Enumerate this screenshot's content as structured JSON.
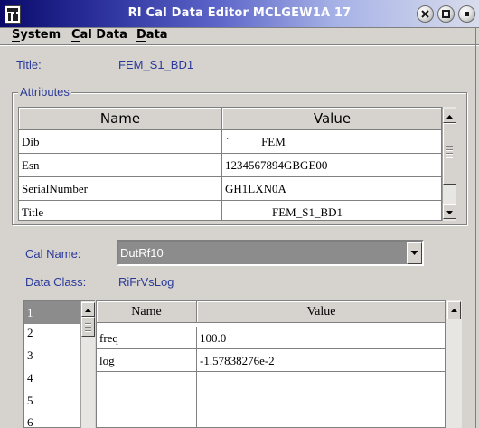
{
  "window": {
    "title": "RI Cal Data Editor MCLGEW1A 17"
  },
  "menu": {
    "items": [
      {
        "label": "System"
      },
      {
        "label": "Cal Data"
      },
      {
        "label": "Data"
      }
    ]
  },
  "title_field": {
    "label": "Title:",
    "value": "FEM_S1_BD1"
  },
  "attributes": {
    "group_label": "Attributes",
    "columns": [
      "Name",
      "Value"
    ],
    "rows": [
      {
        "name": "Dib",
        "value": "`           FEM"
      },
      {
        "name": "Esn",
        "value": "1234567894GBGE00"
      },
      {
        "name": "SerialNumber",
        "value": "GH1LXN0A"
      },
      {
        "name": "Title",
        "value": "                FEM_S1_BD1"
      }
    ]
  },
  "cal_name": {
    "label": "Cal Name:",
    "selected": "DutRf10"
  },
  "data_class": {
    "label": "Data Class:",
    "value": "RiFrVsLog"
  },
  "index_list": {
    "items": [
      "1",
      "2",
      "3",
      "4",
      "5",
      "6"
    ],
    "selected_index": 0
  },
  "data_table": {
    "columns": [
      "Name",
      "Value"
    ],
    "rows": [
      {
        "name": "freq",
        "value": "100.0"
      },
      {
        "name": "log",
        "value": "-1.57838276e-2"
      },
      {
        "name": "",
        "value": ""
      },
      {
        "name": "",
        "value": ""
      }
    ]
  },
  "icons": {
    "app": "ri-app-icon",
    "close": "close-icon",
    "maximize": "maximize-icon",
    "minimize": "minimize-icon",
    "scroll_up": "arrow-up-icon",
    "scroll_down": "arrow-down-icon",
    "dropdown": "triangle-down-icon"
  }
}
